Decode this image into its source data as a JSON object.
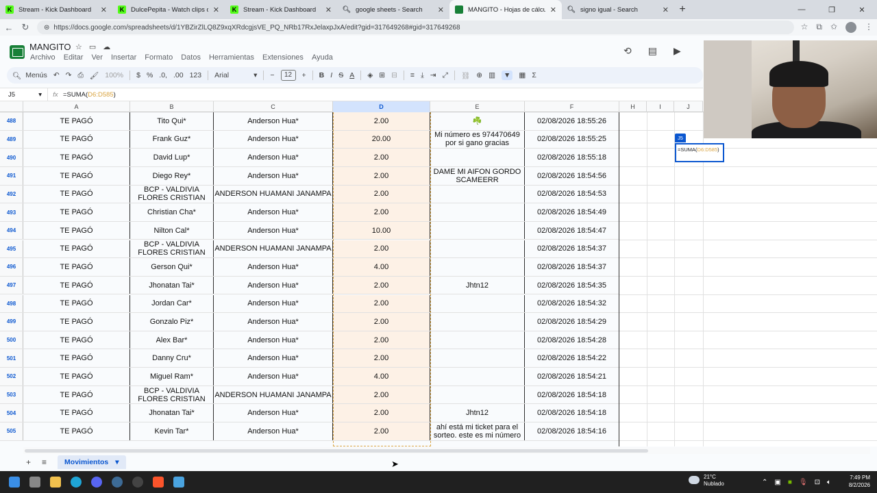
{
  "browser": {
    "tabs": [
      {
        "title": "Stream - Kick Dashboard",
        "icon": "kick-icon",
        "active": false
      },
      {
        "title": "DulcePepita - Watch clips on Kick",
        "icon": "kick-icon",
        "active": false
      },
      {
        "title": "Stream - Kick Dashboard",
        "icon": "kick-icon",
        "active": false
      },
      {
        "title": "google sheets - Search",
        "icon": "search-icon",
        "active": false
      },
      {
        "title": "MANGITO - Hojas de cálculo de G",
        "icon": "sheets-icon",
        "active": true
      },
      {
        "title": "signo igual - Search",
        "icon": "search-icon",
        "active": false
      }
    ],
    "url": "https://docs.google.com/spreadsheets/d/1YBZirZlLQ8Z9xqXRdcgjsVE_PQ_NRb17RxJelaxpJxA/edit?gid=317649268#gid=317649268"
  },
  "doc": {
    "title": "MANGITO",
    "menu": [
      "Archivo",
      "Editar",
      "Ver",
      "Insertar",
      "Formato",
      "Datos",
      "Herramientas",
      "Extensiones",
      "Ayuda"
    ]
  },
  "toolbar": {
    "menus_label": "Menús",
    "zoom": "100%",
    "currency": "$",
    "percent": "%",
    "dec_decrease": ".0,",
    "dec_increase": ".00",
    "number_format": "123",
    "font": "Arial",
    "font_size": "12"
  },
  "formula_bar": {
    "cell_ref": "J5",
    "formula_prefix": "=SUMA(",
    "formula_range": "D6:D585",
    "formula_suffix": ")"
  },
  "columns": [
    "A",
    "B",
    "C",
    "D",
    "E",
    "F",
    "H",
    "I",
    "J"
  ],
  "rows": [
    {
      "n": "488",
      "a": "TE PAGÓ",
      "b": "Tito Qui*",
      "c": "Anderson Hua*",
      "d": "2.00",
      "e": "☘️",
      "f": "02/08/2026 18:55:26"
    },
    {
      "n": "489",
      "a": "TE PAGÓ",
      "b": "Frank Guz*",
      "c": "Anderson Hua*",
      "d": "20.00",
      "e": "Mi número es 974470649 por si gano gracias",
      "f": "02/08/2026 18:55:25"
    },
    {
      "n": "490",
      "a": "TE PAGÓ",
      "b": "David Lup*",
      "c": "Anderson Hua*",
      "d": "2.00",
      "e": "",
      "f": "02/08/2026 18:55:18"
    },
    {
      "n": "491",
      "a": "TE PAGÓ",
      "b": "Diego Rey*",
      "c": "Anderson Hua*",
      "d": "2.00",
      "e": "DAME MI AIFON GORDO SCAMEERR",
      "f": "02/08/2026 18:54:56"
    },
    {
      "n": "492",
      "a": "TE PAGÓ",
      "b": "BCP - VALDIVIA FLORES CRISTIAN",
      "c": "ANDERSON HUAMANI JANAMPA",
      "d": "2.00",
      "e": "",
      "f": "02/08/2026 18:54:53"
    },
    {
      "n": "493",
      "a": "TE PAGÓ",
      "b": "Christian Cha*",
      "c": "Anderson Hua*",
      "d": "2.00",
      "e": "",
      "f": "02/08/2026 18:54:49"
    },
    {
      "n": "494",
      "a": "TE PAGÓ",
      "b": "Nilton Cal*",
      "c": "Anderson Hua*",
      "d": "10.00",
      "e": "",
      "f": "02/08/2026 18:54:47"
    },
    {
      "n": "495",
      "a": "TE PAGÓ",
      "b": "BCP - VALDIVIA FLORES CRISTIAN",
      "c": "ANDERSON HUAMANI JANAMPA",
      "d": "2.00",
      "e": "",
      "f": "02/08/2026 18:54:37"
    },
    {
      "n": "496",
      "a": "TE PAGÓ",
      "b": "Gerson Qui*",
      "c": "Anderson Hua*",
      "d": "4.00",
      "e": "",
      "f": "02/08/2026 18:54:37"
    },
    {
      "n": "497",
      "a": "TE PAGÓ",
      "b": "Jhonatan Tai*",
      "c": "Anderson Hua*",
      "d": "2.00",
      "e": "Jhtn12",
      "f": "02/08/2026 18:54:35"
    },
    {
      "n": "498",
      "a": "TE PAGÓ",
      "b": "Jordan Car*",
      "c": "Anderson Hua*",
      "d": "2.00",
      "e": "",
      "f": "02/08/2026 18:54:32"
    },
    {
      "n": "499",
      "a": "TE PAGÓ",
      "b": "Gonzalo Piz*",
      "c": "Anderson Hua*",
      "d": "2.00",
      "e": "",
      "f": "02/08/2026 18:54:29"
    },
    {
      "n": "500",
      "a": "TE PAGÓ",
      "b": "Alex Bar*",
      "c": "Anderson Hua*",
      "d": "2.00",
      "e": "",
      "f": "02/08/2026 18:54:28"
    },
    {
      "n": "501",
      "a": "TE PAGÓ",
      "b": "Danny Cru*",
      "c": "Anderson Hua*",
      "d": "2.00",
      "e": "",
      "f": "02/08/2026 18:54:22"
    },
    {
      "n": "502",
      "a": "TE PAGÓ",
      "b": "Miguel Ram*",
      "c": "Anderson Hua*",
      "d": "4.00",
      "e": "",
      "f": "02/08/2026 18:54:21"
    },
    {
      "n": "503",
      "a": "TE PAGÓ",
      "b": "BCP - VALDIVIA FLORES CRISTIAN",
      "c": "ANDERSON HUAMANI JANAMPA",
      "d": "2.00",
      "e": "",
      "f": "02/08/2026 18:54:18"
    },
    {
      "n": "504",
      "a": "TE PAGÓ",
      "b": "Jhonatan Tai*",
      "c": "Anderson Hua*",
      "d": "2.00",
      "e": "Jhtn12",
      "f": "02/08/2026 18:54:18"
    },
    {
      "n": "505",
      "a": "TE PAGÓ",
      "b": "Kevin Tar*",
      "c": "Anderson Hua*",
      "d": "2.00",
      "e": "ahí está mi ticket para el sorteo. este es mi número",
      "f": "02/08/2026 18:54:16"
    }
  ],
  "active_cell": {
    "label": "J5",
    "formula_prefix": "=SUMA(",
    "formula_range": "D6:D585",
    "formula_suffix": ")"
  },
  "sheet_tab": "Movimientos",
  "taskbar": {
    "temperature": "21°C",
    "weather": "Nublado",
    "time": "7:49 PM",
    "date": "8/2/2026"
  },
  "colors": {
    "accent": "#0b57d0",
    "sheets_green": "#188038",
    "selection_fill": "#fdf1e6",
    "range_border": "#d9a441"
  }
}
